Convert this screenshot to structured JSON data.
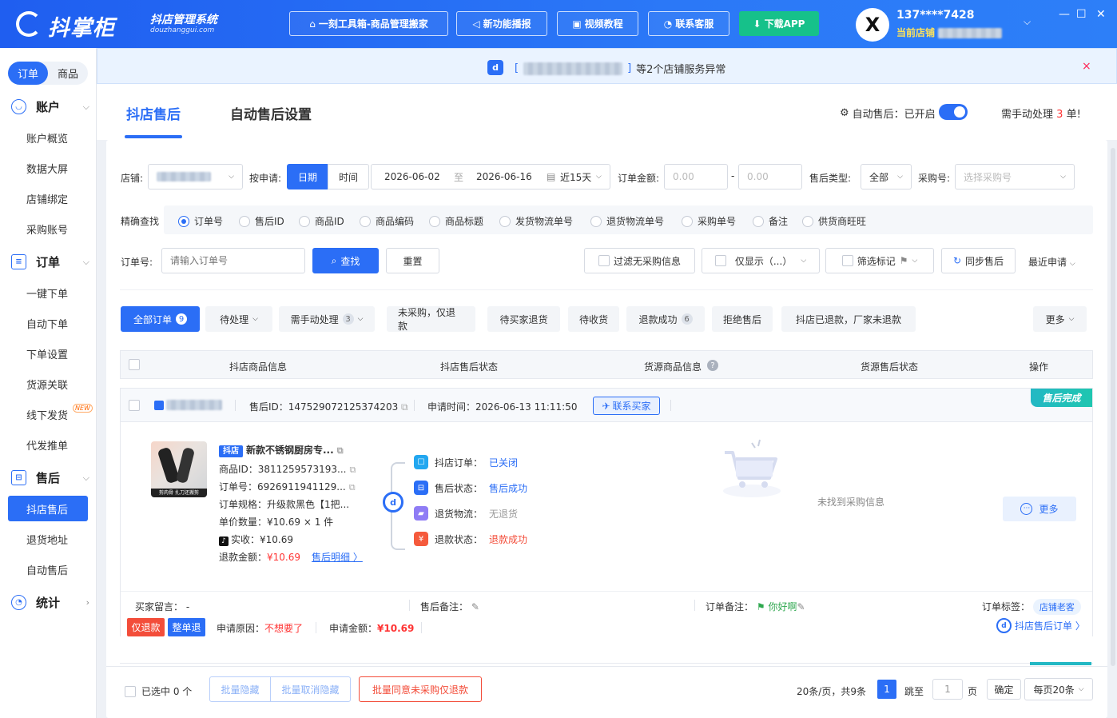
{
  "app": {
    "title": "抖掌柜",
    "subtitle": "抖店管理系统",
    "url": "douzhanggui.com"
  },
  "topbar": {
    "buttons": [
      {
        "label": "一刻工具箱-商品管理搬家",
        "icon": "toolbox-icon"
      },
      {
        "label": "新功能播报",
        "icon": "speaker-icon"
      },
      {
        "label": "视频教程",
        "icon": "video-icon"
      },
      {
        "label": "联系客服",
        "icon": "headset-icon"
      },
      {
        "label": "下载APP",
        "icon": "download-icon"
      }
    ],
    "account": {
      "avatar": "X",
      "name": "137****7428",
      "shop_label": "当前店铺"
    }
  },
  "sidebar": {
    "switch": [
      "订单",
      "商品"
    ],
    "groups": [
      {
        "label": "账户",
        "items": [
          "账户概览",
          "数据大屏",
          "店铺绑定",
          "采购账号"
        ]
      },
      {
        "label": "订单",
        "items": [
          "一键下单",
          "自动下单",
          "下单设置",
          "货源关联",
          "线下发货",
          "代发推单"
        ]
      },
      {
        "label": "售后",
        "items": [
          "抖店售后",
          "退货地址",
          "自动售后"
        ]
      },
      {
        "label": "统计",
        "items": []
      }
    ],
    "new_tag": "NEW"
  },
  "banner": {
    "text": "等2个店铺服务异常"
  },
  "tabs": [
    "抖店售后",
    "自动售后设置"
  ],
  "auto_aftersale": {
    "label": "自动售后：已开启",
    "manual_prefix": "需手动处理",
    "manual_count": "3",
    "manual_suffix": "单!"
  },
  "filters": {
    "shop_label": "店铺:",
    "apply_label": "按申请:",
    "mode": [
      "日期",
      "时间"
    ],
    "date_from": "2026-06-02",
    "date_to_sep": "至",
    "date_to": "2026-06-16",
    "range": "近15天",
    "amount_label": "订单金额:",
    "amount_min": "0.00",
    "amount_sep": "-",
    "amount_max": "0.00",
    "type_label": "售后类型:",
    "type_value": "全部",
    "purchase_label": "采购号:",
    "purchase_placeholder": "选择采购号",
    "exact_label": "精确查找",
    "radios": [
      "订单号",
      "售后ID",
      "商品ID",
      "商品编码",
      "商品标题",
      "发货物流单号",
      "退货物流单号",
      "采购单号",
      "备注",
      "供货商旺旺"
    ],
    "order_no_label": "订单号:",
    "order_no_placeholder": "请输入订单号",
    "search": "查找",
    "reset": "重置",
    "opt_no_purchase": "过滤无采购信息",
    "opt_only_show": "仅显示（...）",
    "opt_mark": "筛选标记",
    "sync": "同步售后",
    "recent": "最近申请"
  },
  "status_tabs": [
    {
      "label": "全部订单",
      "count": "9"
    },
    {
      "label": "待处理",
      "count": ""
    },
    {
      "label": "需手动处理",
      "count": "3"
    },
    {
      "label": "未采购，仅退款",
      "count": ""
    },
    {
      "label": "待买家退货",
      "count": ""
    },
    {
      "label": "待收货",
      "count": ""
    },
    {
      "label": "退款成功",
      "count": "6"
    },
    {
      "label": "拒绝售后",
      "count": ""
    },
    {
      "label": "抖店已退款，厂家未退款",
      "count": ""
    },
    {
      "label": "更多",
      "count": ""
    }
  ],
  "table_headers": [
    "抖店商品信息",
    "抖店售后状态",
    "货源商品信息",
    "货源售后状态",
    "操作"
  ],
  "order": {
    "aftersale_id_label": "售后ID：",
    "aftersale_id": "147529072125374203",
    "apply_time_label": "申请时间：",
    "apply_time": "2026-06-13 11:11:50",
    "contact": "联系买家",
    "badge": "售后完成",
    "thumb_caption": "剪肉骨 扎刀还搬剪",
    "product": {
      "shop_tag": "抖店",
      "title": "新款不锈钢厨房专...",
      "id_label": "商品ID：",
      "id": "3811259573193...",
      "order_label": "订单号：",
      "order": "6926911941129...",
      "spec_label": "订单规格：",
      "spec": "升级款黑色【1把...",
      "price_label": "单价数量：",
      "price": "¥10.69 × 1 件",
      "paid_label": "实收：",
      "paid": "¥10.69",
      "refund_label": "退款金额：",
      "refund": "¥10.69",
      "detail": "售后明细 〉"
    },
    "statuses": [
      {
        "label": "抖店订单：",
        "value": "已关闭",
        "color": "#2b6ef6",
        "icon": "order-icon",
        "bg": "#22a7f0"
      },
      {
        "label": "售后状态：",
        "value": "售后成功",
        "color": "#2b6ef6",
        "icon": "aftersale-icon",
        "bg": "#2b6ef6"
      },
      {
        "label": "退货物流：",
        "value": "无退货",
        "color": "#999999",
        "icon": "truck-icon",
        "bg": "#8f7cf5"
      },
      {
        "label": "退款状态：",
        "value": "退款成功",
        "color": "#f34d3a",
        "icon": "refund-icon",
        "bg": "#f55a3c"
      }
    ],
    "no_purchase": "未找到采购信息",
    "more": "更多",
    "remarks": {
      "buyer_label": "买家留言：",
      "buyer": "-",
      "after_label": "售后备注：",
      "order_label": "订单备注：",
      "order_remark": "你好啊",
      "tag_label": "订单标签：",
      "tag": "店铺老客"
    },
    "footer": {
      "type1": "仅退款",
      "type2": "整单退",
      "reason_label": "申请原因：",
      "reason": "不想要了",
      "amount_label": "申请金额：",
      "amount": "¥10.69",
      "link": "抖店售后订单 〉"
    }
  },
  "bottom": {
    "selected": "已选中 0 个",
    "hide": "批量隐藏",
    "unhide": "批量取消隐藏",
    "agree": "批量同意未采购仅退款",
    "summary": "20条/页，共9条",
    "page": "1",
    "jump": "跳至",
    "jump_value": "1",
    "page_unit": "页",
    "confirm": "确定",
    "per_page": "每页20条"
  }
}
